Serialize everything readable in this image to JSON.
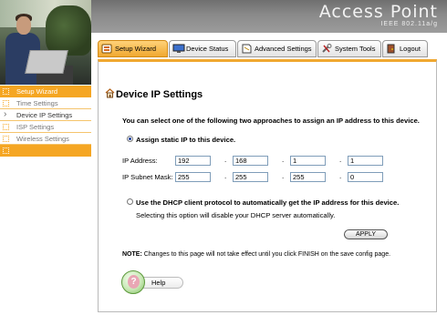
{
  "header": {
    "title": "Access Point",
    "subtitle": "IEEE 802.11a/g"
  },
  "tabs": [
    {
      "label": "Setup Wizard",
      "icon": "setup-wizard-icon",
      "active": true
    },
    {
      "label": "Device Status",
      "icon": "monitor-icon",
      "active": false
    },
    {
      "label": "Advanced Settings",
      "icon": "document-icon",
      "active": false
    },
    {
      "label": "System Tools",
      "icon": "tools-icon",
      "active": false
    },
    {
      "label": "Logout",
      "icon": "logout-icon",
      "active": false
    }
  ],
  "sidebar": {
    "items": [
      {
        "label": "Setup Wizard",
        "type": "header"
      },
      {
        "label": "Time Settings",
        "type": "sub"
      },
      {
        "label": "Device IP Settings",
        "type": "sub",
        "active": true
      },
      {
        "label": "ISP Settings",
        "type": "sub"
      },
      {
        "label": "Wireless Settings",
        "type": "sub"
      }
    ]
  },
  "page": {
    "title": "Device IP Settings",
    "intro": "You can select one of the following two approaches to assign an IP address to this device.",
    "option_static": "Assign static IP to this device.",
    "ip_address_label": "IP Address:",
    "subnet_label": "IP Subnet Mask:",
    "ip_address": [
      "192",
      "168",
      "1",
      "1"
    ],
    "subnet_mask": [
      "255",
      "255",
      "255",
      "0"
    ],
    "dot": ".",
    "option_dhcp": "Use the DHCP client protocol to automatically get the IP address for this device.",
    "dhcp_note": "Selecting this option will disable your DHCP server automatically.",
    "apply_label": "APPLY",
    "note_prefix": "NOTE:",
    "note_text": " Changes to this page will not take effect until you click FINISH on the save config page.",
    "help_label": "Help",
    "help_glyph": "?"
  },
  "colors": {
    "accent": "#f5a623",
    "header_gray": "#8a8a8a",
    "radio_blue": "#1a3c9a"
  }
}
